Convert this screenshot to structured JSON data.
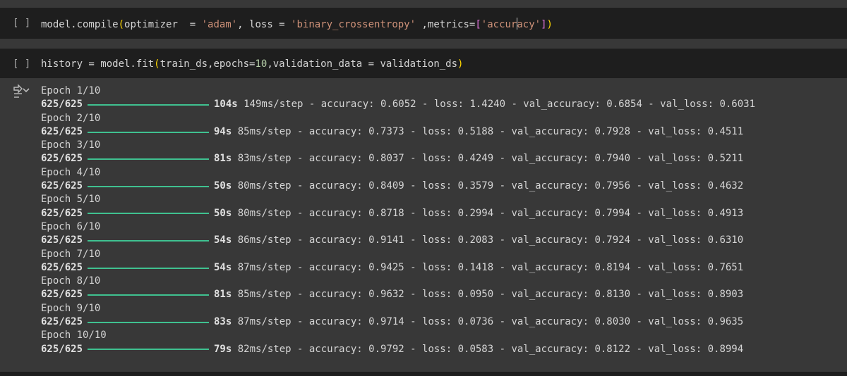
{
  "cells": [
    {
      "run_label": "[ ]",
      "code": {
        "p1": "model.compile",
        "p2": "(",
        "p3": "optimizer  = ",
        "p4": "'adam'",
        "p5": ", loss = ",
        "p6": "'binary_crossentropy'",
        "p7": " ,metrics=",
        "p8": "[",
        "p9": "'accuracy'",
        "p10": "]",
        "p11": ")"
      }
    },
    {
      "run_label": "[ ]",
      "code": {
        "p1": "history = model.fit",
        "p2": "(",
        "p3": "train_ds,epochs=",
        "p4": "10",
        "p5": ",validation_data = validation_ds",
        "p6": ")"
      }
    }
  ],
  "output": {
    "icon": "output-collapse-icon",
    "accent_color": "#3fc190",
    "epochs": [
      {
        "epoch": "Epoch 1/10",
        "steps": "625/625",
        "time": "104s",
        "rest": " 149ms/step - accuracy: 0.6052 - loss: 1.4240 - val_accuracy: 0.6854 - val_loss: 0.6031",
        "progress": 1.0
      },
      {
        "epoch": "Epoch 2/10",
        "steps": "625/625",
        "time": "94s",
        "rest": " 85ms/step - accuracy: 0.7373 - loss: 0.5188 - val_accuracy: 0.7928 - val_loss: 0.4511",
        "progress": 1.0
      },
      {
        "epoch": "Epoch 3/10",
        "steps": "625/625",
        "time": "81s",
        "rest": " 83ms/step - accuracy: 0.8037 - loss: 0.4249 - val_accuracy: 0.7940 - val_loss: 0.5211",
        "progress": 1.0
      },
      {
        "epoch": "Epoch 4/10",
        "steps": "625/625",
        "time": "50s",
        "rest": " 80ms/step - accuracy: 0.8409 - loss: 0.3579 - val_accuracy: 0.7956 - val_loss: 0.4632",
        "progress": 1.0
      },
      {
        "epoch": "Epoch 5/10",
        "steps": "625/625",
        "time": "50s",
        "rest": " 80ms/step - accuracy: 0.8718 - loss: 0.2994 - val_accuracy: 0.7994 - val_loss: 0.4913",
        "progress": 1.0
      },
      {
        "epoch": "Epoch 6/10",
        "steps": "625/625",
        "time": "54s",
        "rest": " 86ms/step - accuracy: 0.9141 - loss: 0.2083 - val_accuracy: 0.7924 - val_loss: 0.6310",
        "progress": 1.0
      },
      {
        "epoch": "Epoch 7/10",
        "steps": "625/625",
        "time": "54s",
        "rest": " 87ms/step - accuracy: 0.9425 - loss: 0.1418 - val_accuracy: 0.8194 - val_loss: 0.7651",
        "progress": 1.0
      },
      {
        "epoch": "Epoch 8/10",
        "steps": "625/625",
        "time": "81s",
        "rest": " 85ms/step - accuracy: 0.9632 - loss: 0.0950 - val_accuracy: 0.8130 - val_loss: 0.8903",
        "progress": 1.0
      },
      {
        "epoch": "Epoch 9/10",
        "steps": "625/625",
        "time": "83s",
        "rest": " 87ms/step - accuracy: 0.9714 - loss: 0.0736 - val_accuracy: 0.8030 - val_loss: 0.9635",
        "progress": 1.0
      },
      {
        "epoch": "Epoch 10/10",
        "steps": "625/625",
        "time": "79s",
        "rest": " 82ms/step - accuracy: 0.9792 - loss: 0.0583 - val_accuracy: 0.8122 - val_loss: 0.8994",
        "progress": 1.0
      }
    ]
  }
}
